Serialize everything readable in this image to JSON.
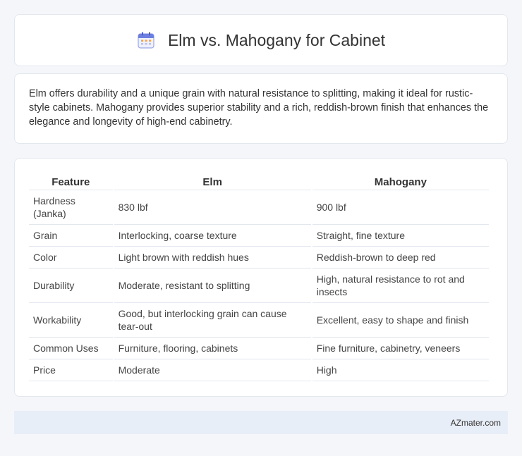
{
  "header": {
    "title": "Elm vs. Mahogany for Cabinet",
    "icon": "calendar-icon"
  },
  "summary": {
    "text": "Elm offers durability and a unique grain with natural resistance to splitting, making it ideal for rustic-style cabinets. Mahogany provides superior stability and a rich, reddish-brown finish that enhances the elegance and longevity of high-end cabinetry."
  },
  "table": {
    "headers": [
      "Feature",
      "Elm",
      "Mahogany"
    ],
    "rows": [
      [
        "Hardness (Janka)",
        "830 lbf",
        "900 lbf"
      ],
      [
        "Grain",
        "Interlocking, coarse texture",
        "Straight, fine texture"
      ],
      [
        "Color",
        "Light brown with reddish hues",
        "Reddish-brown to deep red"
      ],
      [
        "Durability",
        "Moderate, resistant to splitting",
        "High, natural resistance to rot and insects"
      ],
      [
        "Workability",
        "Good, but interlocking grain can cause tear-out",
        "Excellent, easy to shape and finish"
      ],
      [
        "Common Uses",
        "Furniture, flooring, cabinets",
        "Fine furniture, cabinetry, veneers"
      ],
      [
        "Price",
        "Moderate",
        "High"
      ]
    ]
  },
  "footer": {
    "text": "AZmater.com"
  },
  "colors": {
    "background": "#f4f6fa",
    "card": "#ffffff",
    "footer": "#e8eef7",
    "border": "#e3e7ee"
  }
}
